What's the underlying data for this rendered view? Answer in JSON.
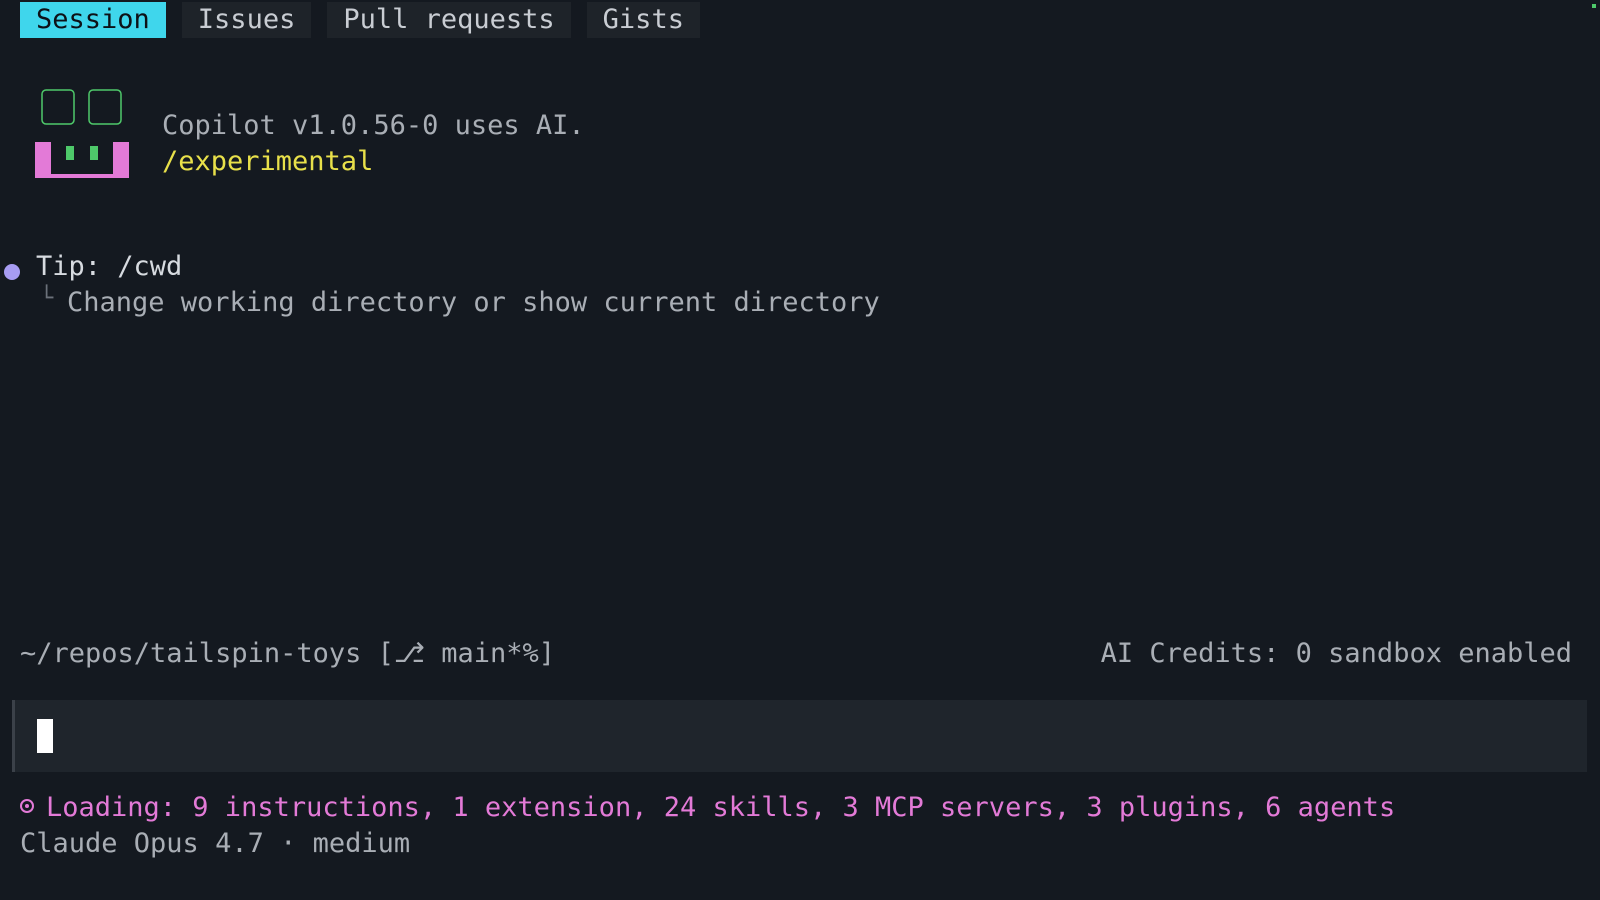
{
  "tabs": [
    {
      "label": "Session",
      "active": true
    },
    {
      "label": "Issues",
      "active": false
    },
    {
      "label": "Pull requests",
      "active": false
    },
    {
      "label": "Gists",
      "active": false
    }
  ],
  "banner": {
    "version_text": "Copilot v1.0.56-0 uses AI.",
    "experimental_text": "/experimental"
  },
  "tip": {
    "title": "Tip: /cwd",
    "branch_glyph": "└",
    "description": "Change working directory or show current directory"
  },
  "status": {
    "cwd": "~/repos/tailspin-toys [⎇ main*%]",
    "right": "AI Credits: 0 sandbox enabled"
  },
  "input": {
    "value": ""
  },
  "loading": {
    "text": "Loading: 9 instructions, 1 extension, 24 skills, 3 MCP servers, 3 plugins, 6 agents"
  },
  "model": {
    "text": "Claude Opus 4.7 · medium"
  },
  "colors": {
    "background": "#141920",
    "tab_active": "#3fd6ec",
    "experimental": "#e8e04a",
    "loading": "#e37ad7",
    "tip_dot": "#a79cf2",
    "logo_pink": "#e37ad7",
    "logo_green": "#4ec96a"
  }
}
